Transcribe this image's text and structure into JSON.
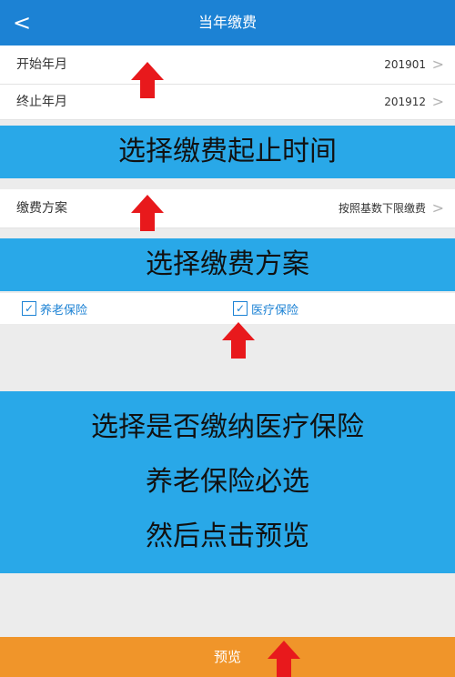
{
  "header": {
    "title": "当年缴费",
    "back_glyph": "<"
  },
  "rows": {
    "start": {
      "label": "开始年月",
      "value": "201901",
      "chev": ">"
    },
    "end": {
      "label": "终止年月",
      "value": "201912",
      "chev": ">"
    },
    "plan": {
      "label": "缴费方案",
      "value": "按照基数下限缴费",
      "chev": ">"
    }
  },
  "banners": {
    "b1": "选择缴费起止时间",
    "b2": "选择缴费方案",
    "b3": {
      "line1": "选择是否缴纳医疗保险",
      "line2": "养老保险必选",
      "line3": "然后点击预览"
    }
  },
  "checks": {
    "pension": {
      "label": "养老保险",
      "mark": "✓"
    },
    "medical": {
      "label": "医疗保险",
      "mark": "✓"
    }
  },
  "footer": {
    "label": "预览"
  },
  "colors": {
    "header": "#1c82d4",
    "banner": "#29a8e8",
    "footer": "#f0952a",
    "arrow": "#e8191c"
  }
}
